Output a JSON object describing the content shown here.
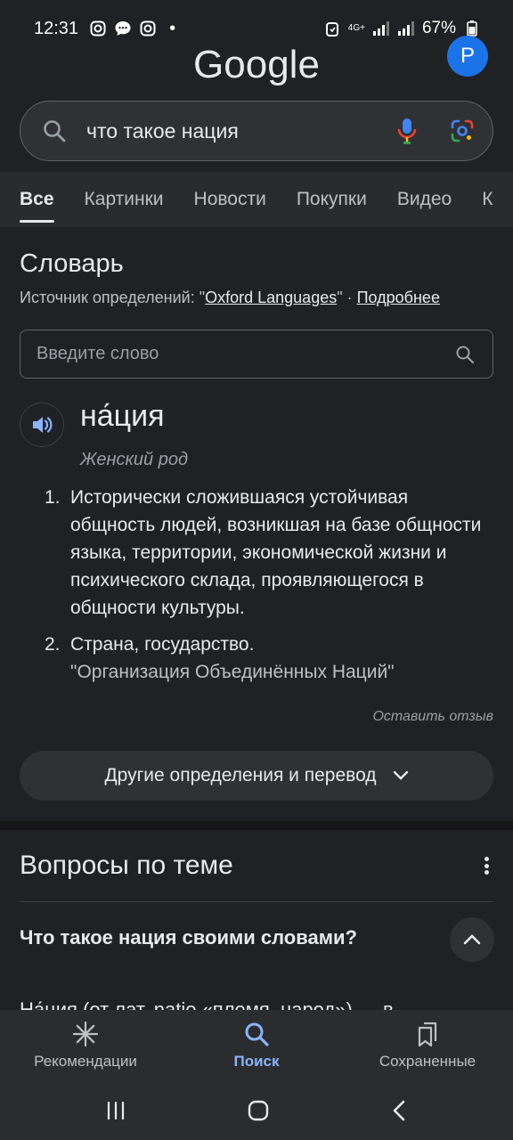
{
  "status_bar": {
    "time": "12:31",
    "dot": "•",
    "network": "4G+",
    "battery": "67%"
  },
  "header": {
    "logo": "Google",
    "avatar_letter": "P"
  },
  "search": {
    "query": "что такое нация"
  },
  "tabs": [
    {
      "label": "Все",
      "active": true
    },
    {
      "label": "Картинки"
    },
    {
      "label": "Новости"
    },
    {
      "label": "Покупки"
    },
    {
      "label": "Видео"
    },
    {
      "label": "К"
    }
  ],
  "dictionary": {
    "title": "Словарь",
    "source_prefix": "Источник определений: \"",
    "source_link": "Oxford Languages",
    "source_suffix": "\" · ",
    "more_link": "Подробнее",
    "input_placeholder": "Введите слово",
    "headword": "на́ция",
    "gender": "Женский род",
    "definitions": [
      {
        "num": "1.",
        "text": "Исторически сложившаяся устойчивая общность людей, возникшая на базе общности языка, территории, экономической жизни и психического склада, проявляющегося в общности культуры."
      },
      {
        "num": "2.",
        "text": "Страна, государство.",
        "example": "\"Организация Объединённых Наций\""
      }
    ],
    "feedback": "Оставить отзыв",
    "more_button": "Другие определения и перевод"
  },
  "related": {
    "title": "Вопросы по теме",
    "question": "Что такое нация своими словами?",
    "answer_peek": "На́ция (от лат. natio «племя, народ») — в"
  },
  "bottom_nav": [
    {
      "label": "Рекомендации",
      "icon": "asterisk-icon"
    },
    {
      "label": "Поиск",
      "icon": "search-icon",
      "active": true
    },
    {
      "label": "Сохраненные",
      "icon": "bookmarks-icon"
    }
  ],
  "colors": {
    "background": "#202124",
    "accent": "#8ab4f8",
    "avatar": "#1a73e8"
  }
}
